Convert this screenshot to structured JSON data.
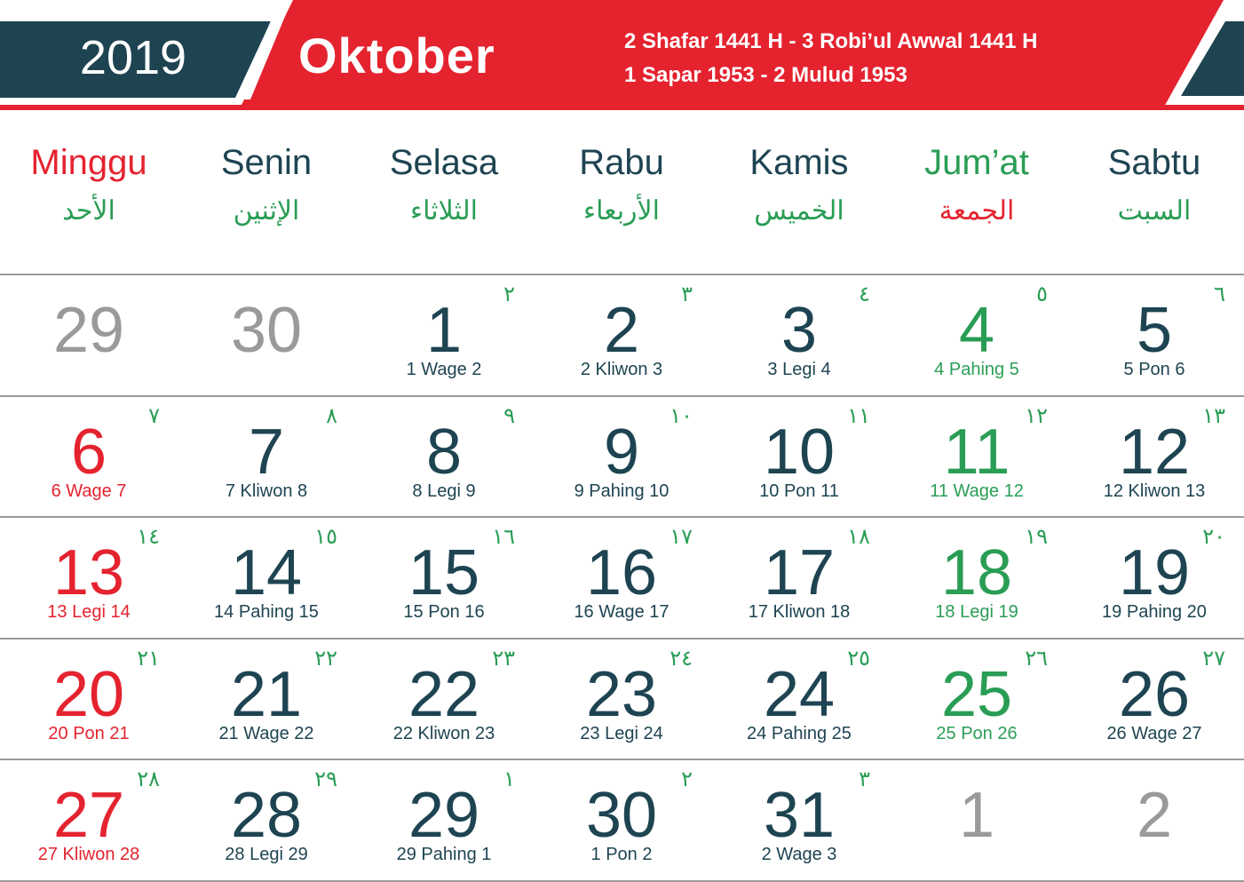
{
  "header": {
    "year": "2019",
    "month": "Oktober",
    "hijri_line": "2 Shafar 1441 H - 3 Robi’ul Awwal 1441 H",
    "javanese_line": "1 Sapar 1953 - 2 Mulud 1953"
  },
  "colors": {
    "banner_red": "#e4232f",
    "banner_teal": "#1e4452",
    "sunday_red": "#e4232f",
    "friday_green": "#2a9d55",
    "weekday_teal": "#1e4452",
    "faded_gray": "#9a9a9a"
  },
  "weekdays": [
    {
      "name": "Minggu",
      "arabic": "الأحد",
      "color": "#e4232f",
      "arabic_color": "#2a9d55"
    },
    {
      "name": "Senin",
      "arabic": "الإثنين",
      "color": "#1e4452",
      "arabic_color": "#2a9d55"
    },
    {
      "name": "Selasa",
      "arabic": "الثلاثاء",
      "color": "#1e4452",
      "arabic_color": "#2a9d55"
    },
    {
      "name": "Rabu",
      "arabic": "الأربعاء",
      "color": "#1e4452",
      "arabic_color": "#2a9d55"
    },
    {
      "name": "Kamis",
      "arabic": "الخميس",
      "color": "#1e4452",
      "arabic_color": "#2a9d55"
    },
    {
      "name": "Jum’at",
      "arabic": "الجمعة",
      "color": "#2a9d55",
      "arabic_color": "#e4232f"
    },
    {
      "name": "Sabtu",
      "arabic": "السبت",
      "color": "#1e4452",
      "arabic_color": "#2a9d55"
    }
  ],
  "weeks": [
    [
      {
        "day": "29",
        "javanese": "",
        "hijri": "",
        "color": "#9a9a9a"
      },
      {
        "day": "30",
        "javanese": "",
        "hijri": "",
        "color": "#9a9a9a"
      },
      {
        "day": "1",
        "javanese": "1 Wage 2",
        "hijri": "٢",
        "color": "#1e4452"
      },
      {
        "day": "2",
        "javanese": "2 Kliwon 3",
        "hijri": "٣",
        "color": "#1e4452"
      },
      {
        "day": "3",
        "javanese": "3 Legi 4",
        "hijri": "٤",
        "color": "#1e4452"
      },
      {
        "day": "4",
        "javanese": "4 Pahing 5",
        "hijri": "٥",
        "color": "#2a9d55"
      },
      {
        "day": "5",
        "javanese": "5 Pon 6",
        "hijri": "٦",
        "color": "#1e4452"
      }
    ],
    [
      {
        "day": "6",
        "javanese": "6 Wage 7",
        "hijri": "٧",
        "color": "#e4232f"
      },
      {
        "day": "7",
        "javanese": "7 Kliwon 8",
        "hijri": "٨",
        "color": "#1e4452"
      },
      {
        "day": "8",
        "javanese": "8 Legi 9",
        "hijri": "٩",
        "color": "#1e4452"
      },
      {
        "day": "9",
        "javanese": "9 Pahing 10",
        "hijri": "١٠",
        "color": "#1e4452"
      },
      {
        "day": "10",
        "javanese": "10 Pon 11",
        "hijri": "١١",
        "color": "#1e4452"
      },
      {
        "day": "11",
        "javanese": "11 Wage 12",
        "hijri": "١٢",
        "color": "#2a9d55"
      },
      {
        "day": "12",
        "javanese": "12 Kliwon 13",
        "hijri": "١٣",
        "color": "#1e4452"
      }
    ],
    [
      {
        "day": "13",
        "javanese": "13 Legi 14",
        "hijri": "١٤",
        "color": "#e4232f"
      },
      {
        "day": "14",
        "javanese": "14 Pahing 15",
        "hijri": "١٥",
        "color": "#1e4452"
      },
      {
        "day": "15",
        "javanese": "15 Pon 16",
        "hijri": "١٦",
        "color": "#1e4452"
      },
      {
        "day": "16",
        "javanese": "16 Wage 17",
        "hijri": "١٧",
        "color": "#1e4452"
      },
      {
        "day": "17",
        "javanese": "17 Kliwon 18",
        "hijri": "١٨",
        "color": "#1e4452"
      },
      {
        "day": "18",
        "javanese": "18 Legi 19",
        "hijri": "١٩",
        "color": "#2a9d55"
      },
      {
        "day": "19",
        "javanese": "19 Pahing 20",
        "hijri": "٢٠",
        "color": "#1e4452"
      }
    ],
    [
      {
        "day": "20",
        "javanese": "20 Pon 21",
        "hijri": "٢١",
        "color": "#e4232f"
      },
      {
        "day": "21",
        "javanese": "21 Wage 22",
        "hijri": "٢٢",
        "color": "#1e4452"
      },
      {
        "day": "22",
        "javanese": "22 Kliwon 23",
        "hijri": "٢٣",
        "color": "#1e4452"
      },
      {
        "day": "23",
        "javanese": "23 Legi 24",
        "hijri": "٢٤",
        "color": "#1e4452"
      },
      {
        "day": "24",
        "javanese": "24 Pahing 25",
        "hijri": "٢٥",
        "color": "#1e4452"
      },
      {
        "day": "25",
        "javanese": "25 Pon 26",
        "hijri": "٢٦",
        "color": "#2a9d55"
      },
      {
        "day": "26",
        "javanese": "26 Wage 27",
        "hijri": "٢٧",
        "color": "#1e4452"
      }
    ],
    [
      {
        "day": "27",
        "javanese": "27 Kliwon 28",
        "hijri": "٢٨",
        "color": "#e4232f"
      },
      {
        "day": "28",
        "javanese": "28 Legi 29",
        "hijri": "٢٩",
        "color": "#1e4452"
      },
      {
        "day": "29",
        "javanese": "29 Pahing 1",
        "hijri": "١",
        "color": "#1e4452"
      },
      {
        "day": "30",
        "javanese": "1 Pon 2",
        "hijri": "٢",
        "color": "#1e4452"
      },
      {
        "day": "31",
        "javanese": "2 Wage 3",
        "hijri": "٣",
        "color": "#1e4452"
      },
      {
        "day": "1",
        "javanese": "",
        "hijri": "",
        "color": "#9a9a9a"
      },
      {
        "day": "2",
        "javanese": "",
        "hijri": "",
        "color": "#9a9a9a"
      }
    ]
  ]
}
